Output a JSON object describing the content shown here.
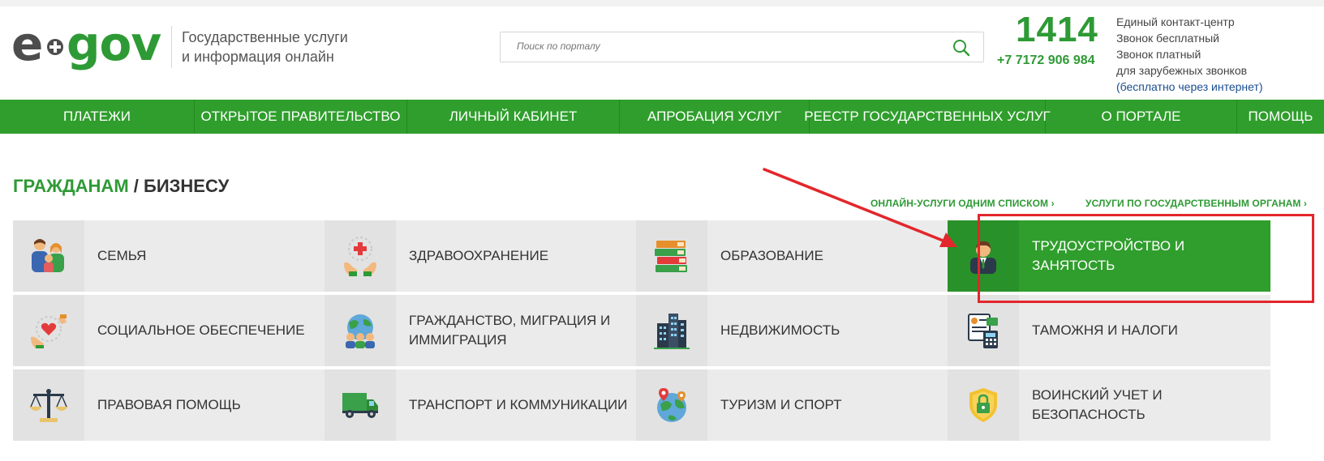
{
  "header": {
    "logo_text_e": "e",
    "logo_text_gov": "gov",
    "tagline_line1": "Государственные услуги",
    "tagline_line2": "и информация онлайн",
    "search_placeholder": "Поиск по порталу",
    "phone_short": "1414",
    "phone_full": "+7 7172 906 984",
    "contact_lines": [
      "Единый контакт-центр",
      "Звонок бесплатный",
      "Звонок платный",
      "для зарубежных звонков",
      "(бесплатно через интернет)"
    ]
  },
  "nav": {
    "items": [
      "ПЛАТЕЖИ",
      "ОТКРЫТОЕ ПРАВИТЕЛЬСТВО",
      "ЛИЧНЫЙ КАБИНЕТ",
      "АПРОБАЦИЯ УСЛУГ",
      "РЕЕСТР ГОСУДАРСТВЕННЫХ УСЛУГ",
      "О ПОРТАЛЕ",
      "ПОМОЩЬ"
    ]
  },
  "section": {
    "title_citizens": "ГРАЖДАНАМ",
    "title_sep": " / ",
    "title_business": "БИЗНЕСУ",
    "link_list": "ОНЛАЙН-УСЛУГИ ОДНИМ СПИСКОМ ›",
    "link_agencies": "УСЛУГИ ПО ГОСУДАРСТВЕННЫМ ОРГАНАМ ›"
  },
  "categories": [
    {
      "label": "СЕМЬЯ",
      "icon": "family-icon"
    },
    {
      "label": "ЗДРАВООХРАНЕНИЕ",
      "icon": "healthcare-icon"
    },
    {
      "label": "ОБРАЗОВАНИЕ",
      "icon": "books-icon"
    },
    {
      "label": "ТРУДОУСТРОЙСТВО И ЗАНЯТОСТЬ",
      "icon": "employee-icon",
      "active": true
    },
    {
      "label": "СОЦИАЛЬНОЕ ОБЕСПЕЧЕНИЕ",
      "icon": "social-care-icon"
    },
    {
      "label": "ГРАЖДАНСТВО, МИГРАЦИЯ И ИММИГРАЦИЯ",
      "icon": "globe-people-icon"
    },
    {
      "label": "НЕДВИЖИМОСТЬ",
      "icon": "buildings-icon"
    },
    {
      "label": "ТАМОЖНЯ И НАЛОГИ",
      "icon": "customs-taxes-icon"
    },
    {
      "label": "ПРАВОВАЯ ПОМОЩЬ",
      "icon": "scales-icon"
    },
    {
      "label": "ТРАНСПОРТ И КОММУНИКАЦИИ",
      "icon": "truck-icon"
    },
    {
      "label": "ТУРИЗМ И СПОРТ",
      "icon": "globe-pins-icon"
    },
    {
      "label": "ВОИНСКИЙ УЧЕТ И БЕЗОПАСНОСТЬ",
      "icon": "shield-lock-icon"
    }
  ],
  "colors": {
    "brand_green": "#2f9e2c",
    "annotation_red": "#e3262b"
  }
}
